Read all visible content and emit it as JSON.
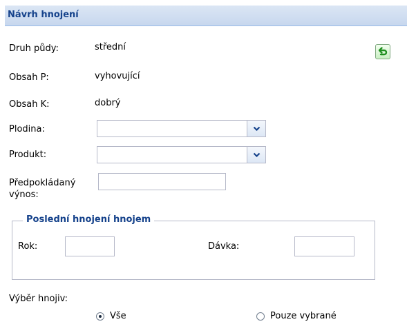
{
  "panel": {
    "title": "Návrh hnojení"
  },
  "info": {
    "druh_pudy": {
      "label": "Druh půdy:",
      "value": "střední"
    },
    "obsah_p": {
      "label": "Obsah P:",
      "value": "vyhovující"
    },
    "obsah_k": {
      "label": "Obsah K:",
      "value": "dobrý"
    }
  },
  "form": {
    "plodina": {
      "label": "Plodina:",
      "value": ""
    },
    "produkt": {
      "label": "Produkt:",
      "value": ""
    },
    "vynos": {
      "label_line1": "Předpokládaný",
      "label_line2": "výnos:",
      "value": ""
    }
  },
  "posledni_hnojeni": {
    "legend": "Poslední hnojení hnojem",
    "rok": {
      "label": "Rok:",
      "value": ""
    },
    "davka": {
      "label": "Dávka:",
      "value": ""
    }
  },
  "vyber_hnojiv": {
    "label": "Výběr hnojiv:",
    "options": [
      {
        "label": "Vše",
        "checked": true
      },
      {
        "label": "Pouze vybrané",
        "checked": false
      }
    ]
  },
  "icons": {
    "back": "undo-arrow-icon",
    "dropdown": "chevron-down-icon"
  },
  "colors": {
    "header_text": "#15428b",
    "header_bg": "#c7d7ee",
    "border": "#b5b8c8",
    "back_arrow": "#1f8f1f"
  }
}
